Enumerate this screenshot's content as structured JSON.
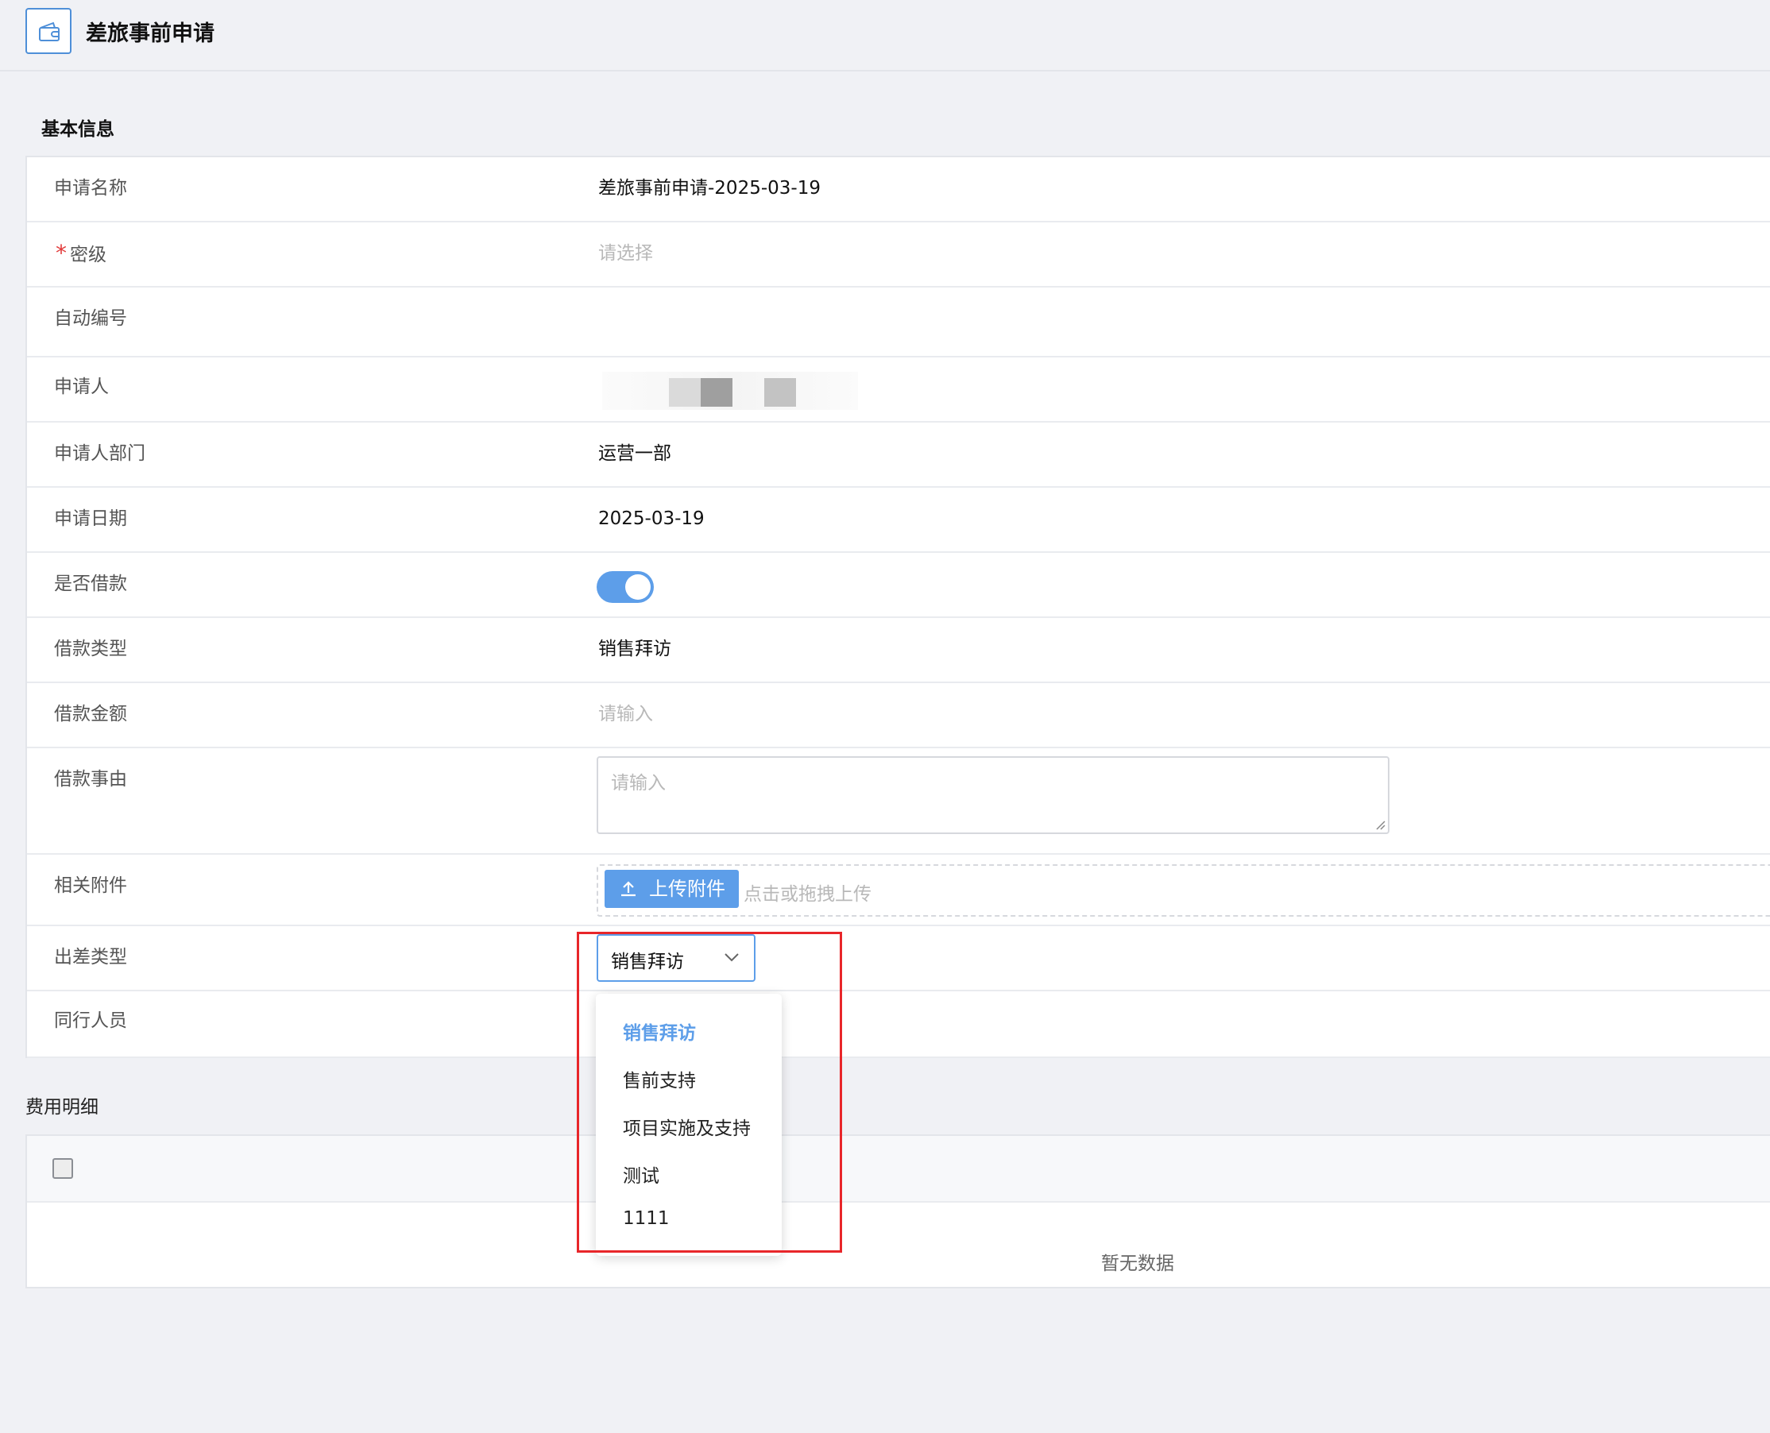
{
  "header": {
    "title": "差旅事前申请",
    "icon": "wallet-icon"
  },
  "sections": {
    "basic_info": "基本信息",
    "expense_detail": "费用明细"
  },
  "form": {
    "application_name": {
      "label": "申请名称",
      "value": "差旅事前申请-2025-03-19"
    },
    "security_level": {
      "label": "密级",
      "required_mark": "*",
      "placeholder": "请选择"
    },
    "auto_number": {
      "label": "自动编号",
      "value": ""
    },
    "applicant": {
      "label": "申请人"
    },
    "applicant_dept": {
      "label": "申请人部门",
      "value": "运营一部"
    },
    "apply_date": {
      "label": "申请日期",
      "value": "2025-03-19"
    },
    "is_loan": {
      "label": "是否借款",
      "on": true
    },
    "loan_type": {
      "label": "借款类型",
      "value": "销售拜访"
    },
    "loan_amount": {
      "label": "借款金额",
      "placeholder": "请输入"
    },
    "loan_reason": {
      "label": "借款事由",
      "placeholder": "请输入"
    },
    "attachments": {
      "label": "相关附件",
      "button": "上传附件",
      "hint": "点击或拖拽上传"
    },
    "trip_type": {
      "label": "出差类型",
      "value": "销售拜访"
    },
    "companions": {
      "label": "同行人员"
    }
  },
  "trip_type_options": [
    "销售拜访",
    "售前支持",
    "项目实施及支持",
    "测试",
    "1111"
  ],
  "table": {
    "empty_text": "暂无数据"
  },
  "colors": {
    "accent": "#5d9ee9",
    "highlight": "#e8262a",
    "required": "#e23b3b"
  }
}
